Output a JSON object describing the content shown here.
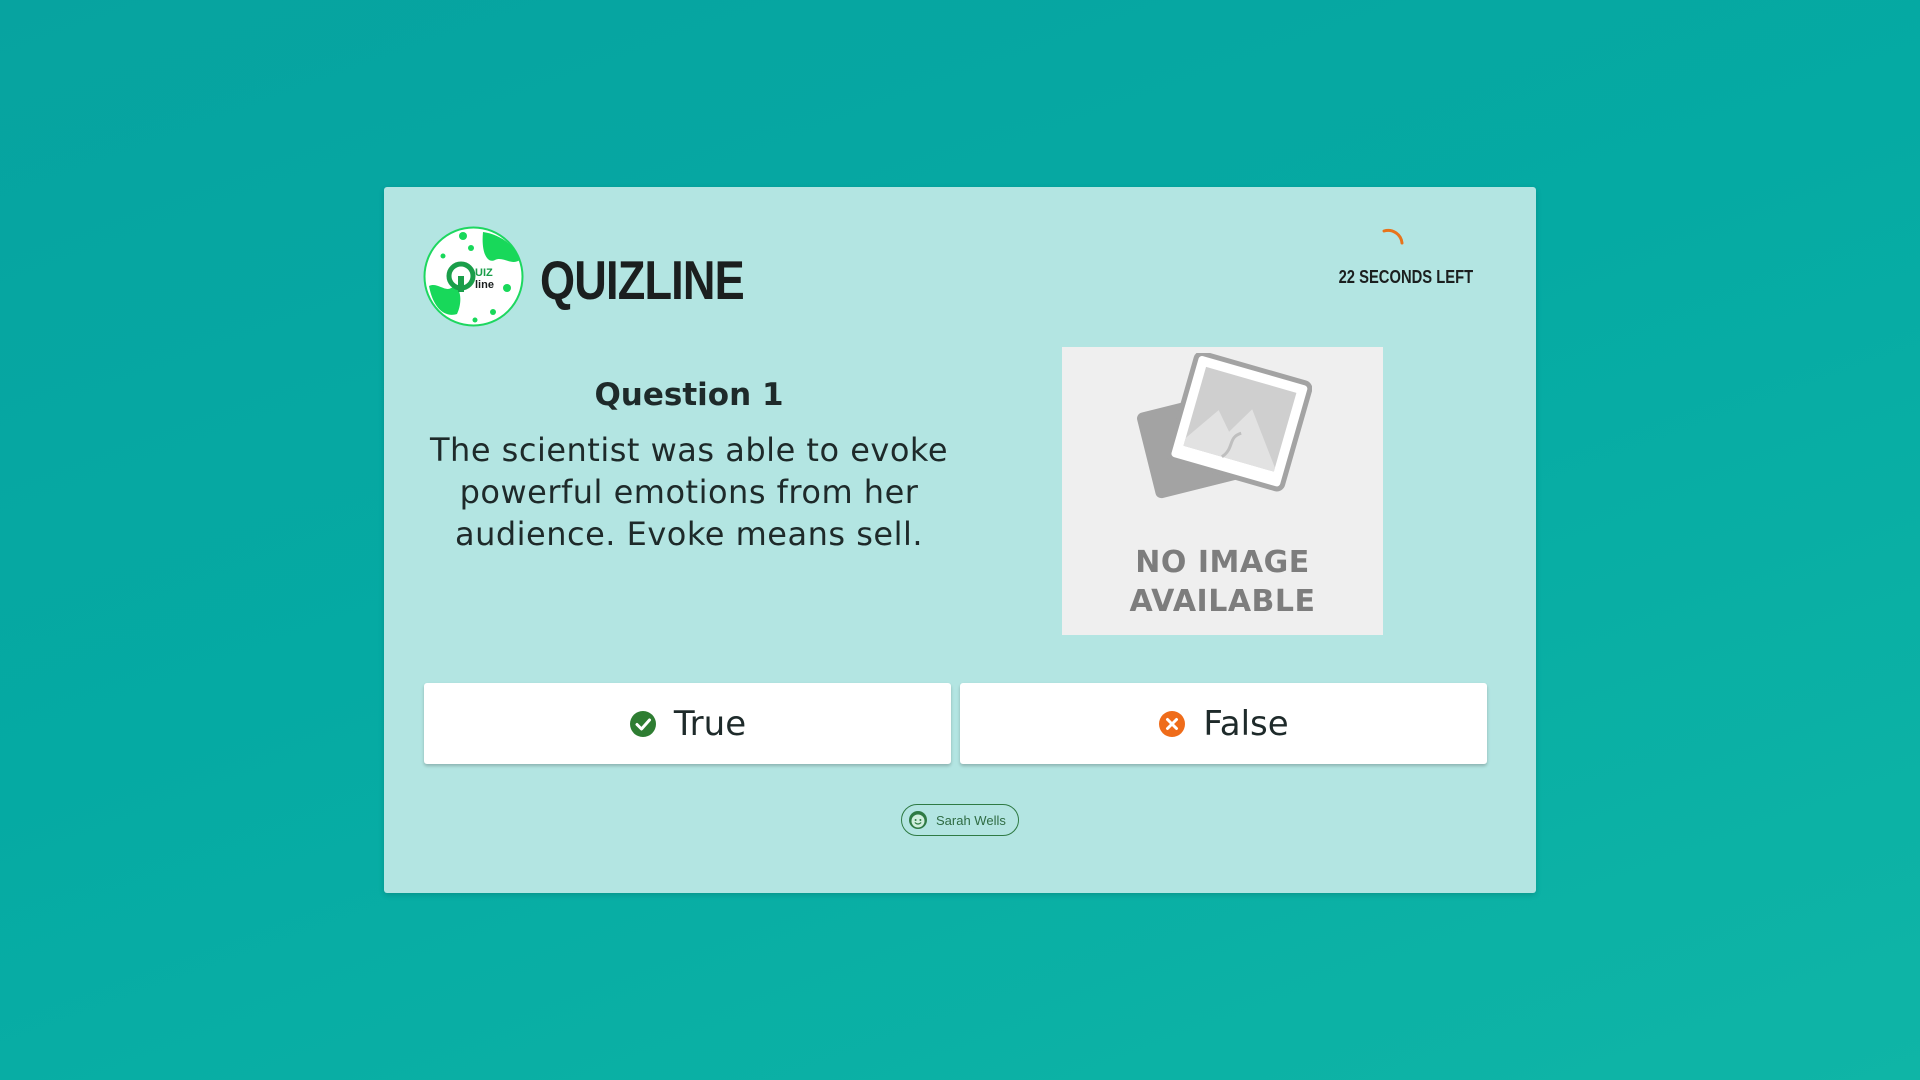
{
  "brand": {
    "name": "QUIZLINE",
    "logo_text_q": "Q",
    "logo_text_uiz": "UIZ",
    "logo_text_line": "line"
  },
  "timer": {
    "text": "22 SECONDS LEFT",
    "accent_color": "#e8731a"
  },
  "question": {
    "title": "Question 1",
    "text": "The scientist was able to evoke powerful emotions from her audience. Evoke means sell."
  },
  "image_placeholder": {
    "line1": "NO IMAGE",
    "line2": "AVAILABLE"
  },
  "answers": {
    "true": {
      "label": "True",
      "icon": "check-circle-icon",
      "color": "#2e7d32"
    },
    "false": {
      "label": "False",
      "icon": "x-circle-icon",
      "color": "#ef6c1a"
    }
  },
  "player": {
    "name": "Sarah Wells",
    "icon": "smiley-avatar-icon"
  },
  "colors": {
    "background": "#05aaa3",
    "card": "#b3e5e2",
    "logo_green": "#1ed760"
  }
}
